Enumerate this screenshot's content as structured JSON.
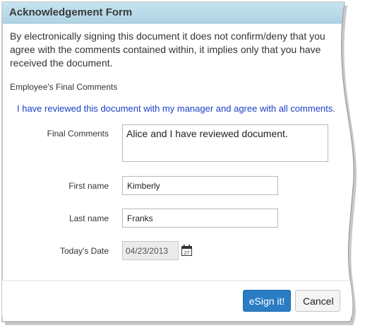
{
  "dialog": {
    "title": "Acknowledgement Form",
    "close_glyph": "×",
    "intro": "By electronically signing this document it does not confirm/deny that you agree with the comments contained within, it implies only that you have received the document.",
    "section_label": "Employee's Final Comments",
    "note": "I have reviewed this document with my manager and agree with all comments."
  },
  "form": {
    "final_comments": {
      "label": "Final Comments",
      "value": "Alice and I have reviewed document."
    },
    "first_name": {
      "label": "First name",
      "value": "Kimberly"
    },
    "last_name": {
      "label": "Last name",
      "value": "Franks"
    },
    "todays_date": {
      "label": "Today's Date",
      "value": "04/23/2013"
    },
    "calendar_day": "27"
  },
  "buttons": {
    "esign": "eSign it!",
    "cancel": "Cancel"
  },
  "colors": {
    "title_bar": "#b9dbe9",
    "note_text": "#1b3fc7",
    "esign_button": "#2a7cc5"
  },
  "icons": {
    "close": "close-icon",
    "calendar": "calendar-icon"
  }
}
